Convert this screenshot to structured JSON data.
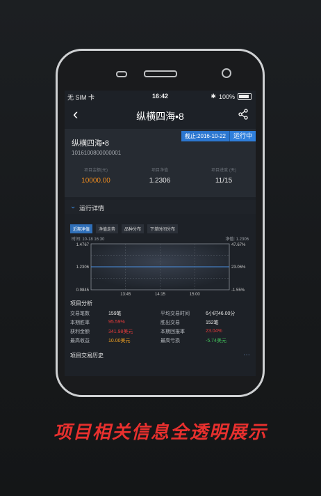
{
  "status": {
    "carrier": "无 SIM 卡",
    "time": "16:42",
    "battery": "100%"
  },
  "nav": {
    "title": "纵横四海•8"
  },
  "project": {
    "name": "纵横四海•8",
    "code": "1016100800000001",
    "date_tag": "截止:2016-10-22",
    "state": "运行中",
    "metrics": [
      {
        "label": "项目金额(元)",
        "value": "10000.00",
        "color": "#f08c1e"
      },
      {
        "label": "项目净值",
        "value": "1.2306",
        "color": "#e9e9e9"
      },
      {
        "label": "项目进度 (天)",
        "value": "11/15",
        "color": "#e9e9e9"
      }
    ]
  },
  "section_title": "运行详情",
  "tabs": [
    "近期净值",
    "净值走势",
    "品种分布",
    "下单时间分布"
  ],
  "chart_header": {
    "left": "时间:   10-18 16:30",
    "right": "净值:   1.2306"
  },
  "chart_data": {
    "type": "line",
    "y_ticks": [
      "1.4767",
      "1.2306",
      "0.9845"
    ],
    "y2_ticks": [
      "47.67%",
      "23.06%",
      "-1.55%"
    ],
    "x_ticks": [
      "13:45",
      "14:15",
      "15:00"
    ],
    "series": [
      {
        "values": [
          1.2306,
          1.2306
        ]
      }
    ],
    "ylim": [
      0.9845,
      1.4767
    ]
  },
  "analysis": {
    "title": "项目分析",
    "rows": [
      {
        "l1": "交易笔数",
        "v1": "159笔",
        "c1": "#e6e6e6",
        "l2": "平均交易时间",
        "v2": "6小时46.00分",
        "c2": "#e6e6e6"
      },
      {
        "l1": "本期胜率",
        "v1": "95.59%",
        "c1": "#e03b3b",
        "l2": "胜出交易",
        "v2": "152笔",
        "c2": "#e6e6e6"
      },
      {
        "l1": "获利金额",
        "v1": "341.98美元",
        "c1": "#e03b3b",
        "l2": "本期回报率",
        "v2": "23.04%",
        "c2": "#e03b3b"
      },
      {
        "l1": "最高收益",
        "v1": "10.00美元",
        "c1": "#f0a020",
        "l2": "最高亏损",
        "v2": "-5.74美元",
        "c2": "#3fbf5a"
      }
    ]
  },
  "history_title": "项目交易历史",
  "slogan": "项目相关信息全透明展示"
}
